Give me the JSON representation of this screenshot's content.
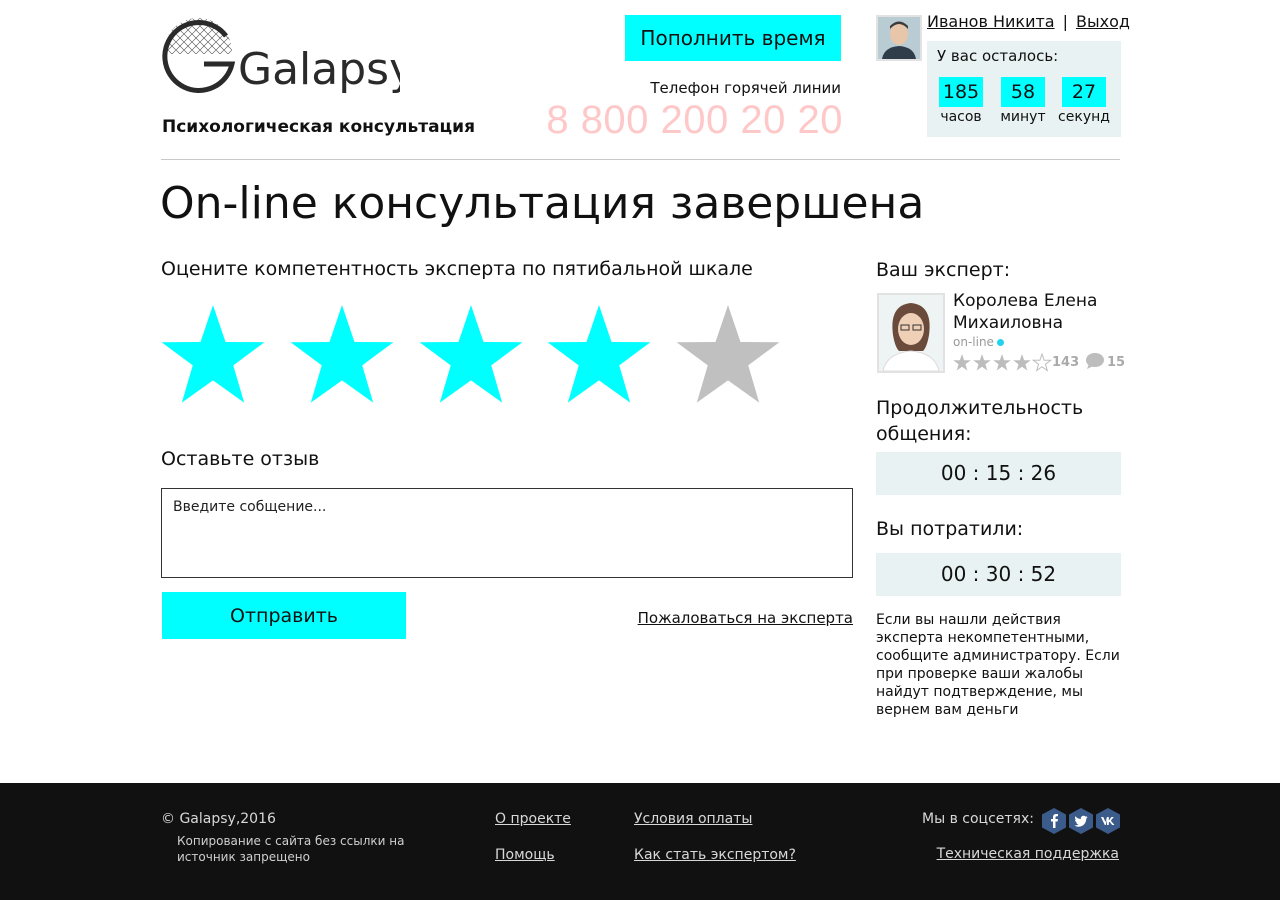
{
  "header": {
    "logo_text": "Galapsy",
    "tagline": "Психологическая консультация",
    "topup_button": "Пополнить время",
    "hotline_label": "Телефон горячей линии",
    "hotline_number": "8 800 200 20 20",
    "user_name": "Иванов Никита",
    "separator": "|",
    "logout": "Выход",
    "remaining": {
      "title": "У вас осталось:",
      "hours": "185",
      "hours_label": "часов",
      "minutes": "58",
      "minutes_label": "минут",
      "seconds": "27",
      "seconds_label": "секунд"
    }
  },
  "main": {
    "title": "On-line консультация завершена",
    "rate_heading": "Оцените компетентность эксперта по пятибальной шкале",
    "rating": {
      "value": 4,
      "max": 5
    },
    "review_heading": "Оставьте отзыв",
    "review_placeholder": "Введите собщение...",
    "send_button": "Отправить",
    "complain_link": "Пожаловаться на эксперта"
  },
  "sidebar": {
    "expert_heading": "Ваш эксперт:",
    "expert_name": "Королева Елена Михаиловна",
    "expert_status": "on-line",
    "expert_rating": {
      "value": 4,
      "max": 5
    },
    "rating_count": "143",
    "comment_count": "15",
    "duration_heading": "Продолжительность общения:",
    "duration": "00 : 15 : 26",
    "spent_heading": "Вы потратили:",
    "spent": "00 : 30 : 52",
    "note": "Если вы нашли действия эксперта некомпетентными, сообщите администратору. Если при проверке ваши жалобы найдут подтверждение, мы вернем вам деньги"
  },
  "footer": {
    "copyright": "© Galapsy,2016",
    "copy_note": "Копирование с сайта без ссылки на источник запрещено",
    "links": {
      "about": "О проекте",
      "payment": "Условия оплаты",
      "help": "Помощь",
      "become_expert": "Как стать экспертом?",
      "support": "Техническая поддержка"
    },
    "social_label": "Мы в соцсетях:",
    "social_icons": [
      "facebook-icon",
      "twitter-icon",
      "vk-icon"
    ]
  },
  "colors": {
    "accent": "#00ffff",
    "star_active": "#00ffff",
    "star_inactive": "#c0c0c0",
    "hotline": "#ffc8c8",
    "panel_bg": "#e9f2f2",
    "footer_bg": "#111111",
    "social_bg": "#3b5b8a"
  }
}
